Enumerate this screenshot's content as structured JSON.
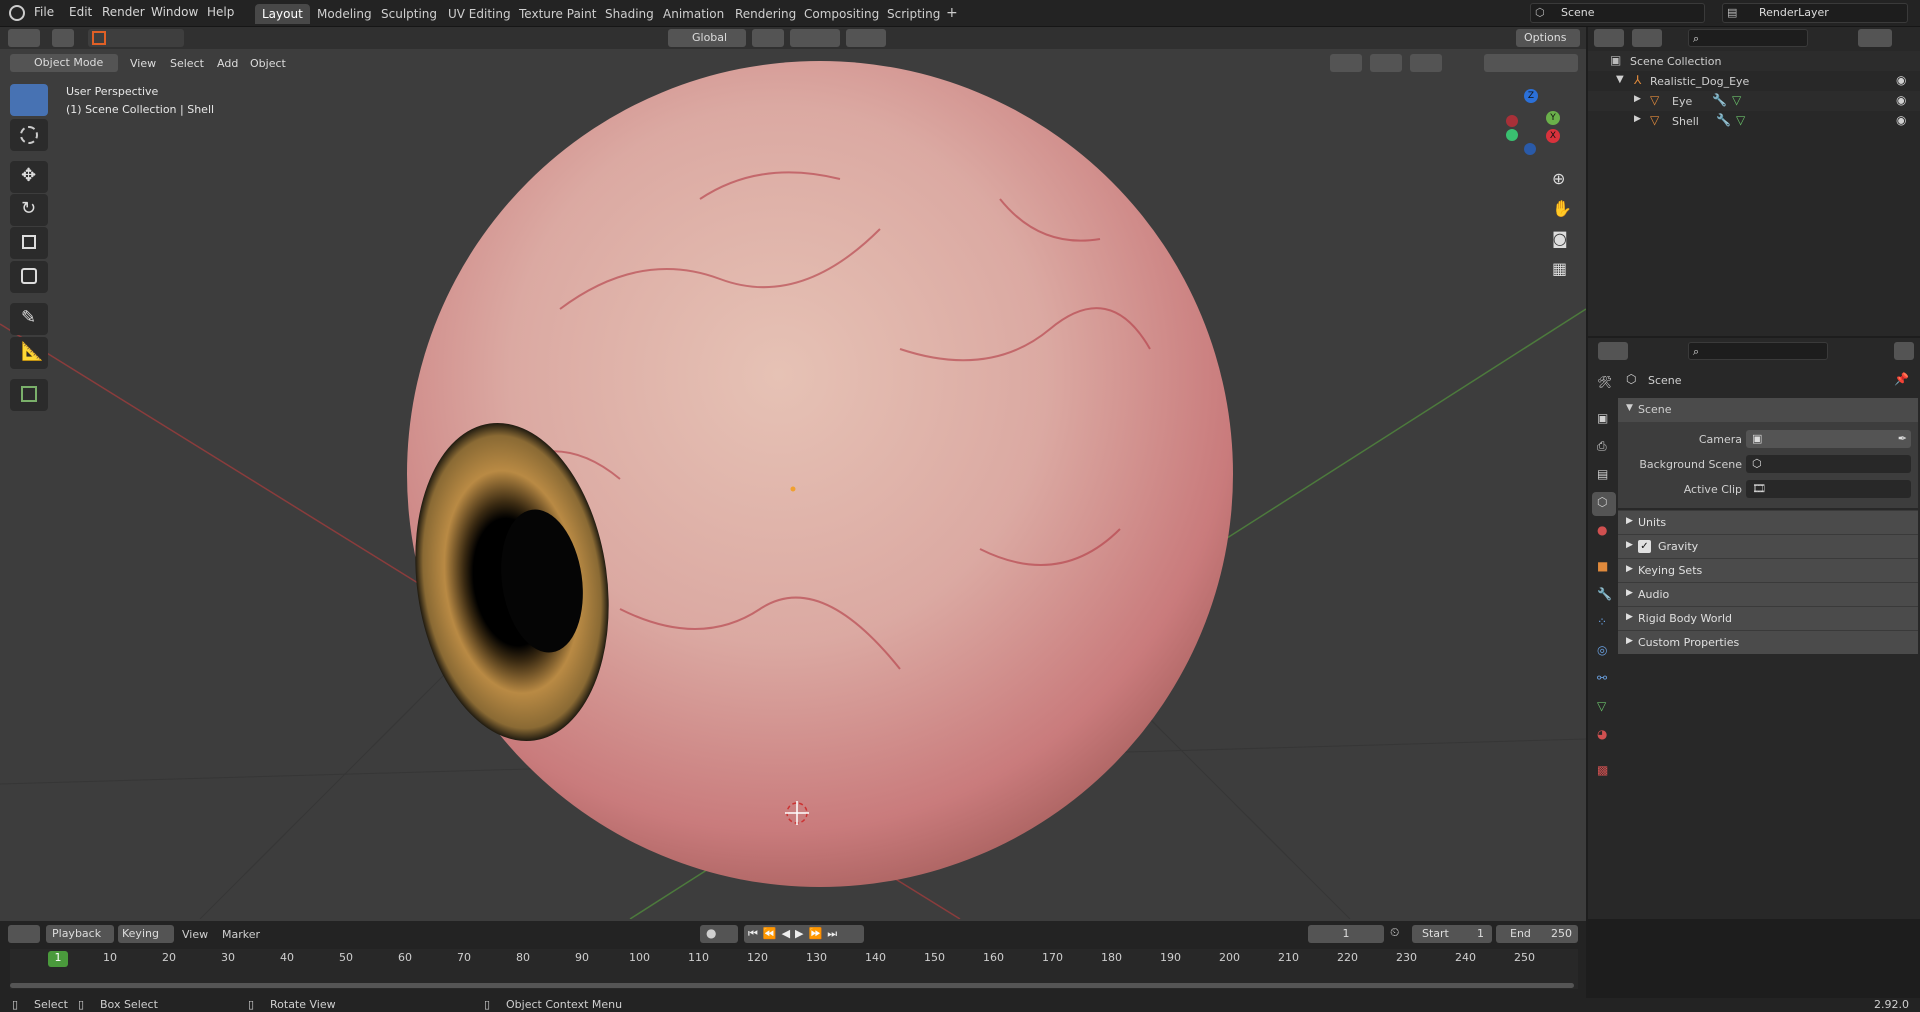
{
  "menu": {
    "file": "File",
    "edit": "Edit",
    "render": "Render",
    "window": "Window",
    "help": "Help"
  },
  "workspaces": [
    "Layout",
    "Modeling",
    "Sculpting",
    "UV Editing",
    "Texture Paint",
    "Shading",
    "Animation",
    "Rendering",
    "Compositing",
    "Scripting"
  ],
  "scene_field": "Scene",
  "renderlayer_field": "RenderLayer",
  "viewport": {
    "mode": "Object Mode",
    "view": "View",
    "select": "Select",
    "add": "Add",
    "object": "Object",
    "orientation": "Global",
    "options": "Options",
    "perspective": "User Perspective",
    "collection_info": "(1) Scene Collection | Shell"
  },
  "gizmo": {
    "z": "Z",
    "y": "Y",
    "x": "X"
  },
  "outliner": {
    "root": "Scene Collection",
    "collection": "Realistic_Dog_Eye",
    "items": [
      "Eye",
      "Shell"
    ]
  },
  "properties": {
    "header": "Scene",
    "section": "Scene",
    "camera_label": "Camera",
    "background_label": "Background Scene",
    "clip_label": "Active Clip",
    "subpanels": [
      "Units",
      "Gravity",
      "Keying Sets",
      "Audio",
      "Rigid Body World",
      "Custom Properties"
    ],
    "gravity_checked": true
  },
  "timeline": {
    "playback": "Playback",
    "keying": "Keying",
    "view": "View",
    "marker": "Marker",
    "current_frame": "1",
    "start_label": "Start",
    "start": "1",
    "end_label": "End",
    "end": "250",
    "ticks": [
      "1",
      "10",
      "20",
      "30",
      "40",
      "50",
      "60",
      "70",
      "80",
      "90",
      "100",
      "110",
      "120",
      "130",
      "140",
      "150",
      "160",
      "170",
      "180",
      "190",
      "200",
      "210",
      "220",
      "230",
      "240",
      "250"
    ]
  },
  "statusbar": {
    "select": "Select",
    "box_select": "Box Select",
    "rotate": "Rotate View",
    "context": "Object Context Menu",
    "version": "2.92.0"
  },
  "colors": {
    "accent": "#4772b3",
    "active_tool": "#e06026",
    "eye_sclera": "#d8a4a2",
    "iris": "#b88a44"
  }
}
